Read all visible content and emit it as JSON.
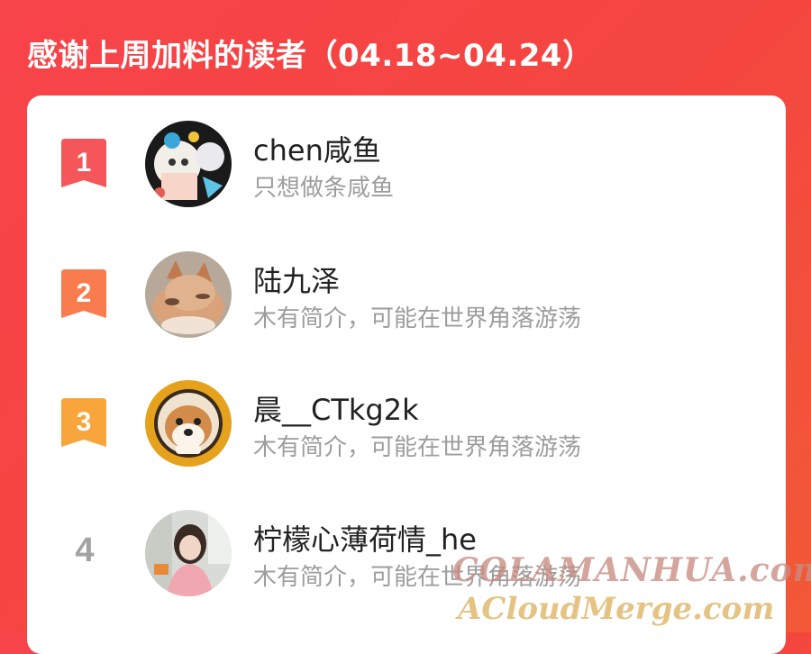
{
  "header": {
    "title": "感谢上周加料的读者（04.18~04.24）"
  },
  "readers": [
    {
      "rank": "1",
      "name": "chen咸鱼",
      "bio": "只想做条咸鱼",
      "badge_color": "#f4565a",
      "avatar": "anime-illustration-avatar"
    },
    {
      "rank": "2",
      "name": "陆九泽",
      "bio": "木有简介，可能在世界角落游荡",
      "badge_color": "#f97c4e",
      "avatar": "fox-photo-avatar"
    },
    {
      "rank": "3",
      "name": "晨__CTkg2k",
      "bio": "木有简介，可能在世界角落游荡",
      "badge_color": "#f8a53b",
      "avatar": "shiba-dog-avatar"
    },
    {
      "rank": "4",
      "name": "柠檬心薄荷情_he",
      "bio": "木有简介，可能在世界角落游荡",
      "avatar": "girl-photo-avatar"
    }
  ],
  "watermark": {
    "line1": "COLAMANHUA.com",
    "line2": "ACloudMerge.com"
  }
}
